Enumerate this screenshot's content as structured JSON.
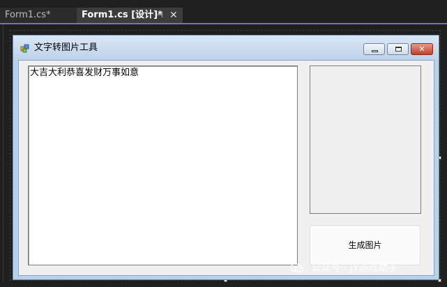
{
  "tabs": {
    "inactive_label": "Form1.cs*",
    "active_label": "Form1.cs [设计]*"
  },
  "form": {
    "title": "文字转图片工具",
    "textbox_value": "大吉大利恭喜发财万事如意",
    "button_label": "生成图片"
  },
  "watermark": {
    "text": "公众号 · JY游戏助手"
  },
  "colors": {
    "ide_background": "#1f1f1f",
    "active_tab_underline": "#7d6cc9",
    "form_border": "#b9d1ea",
    "close_button": "#c4402a"
  }
}
